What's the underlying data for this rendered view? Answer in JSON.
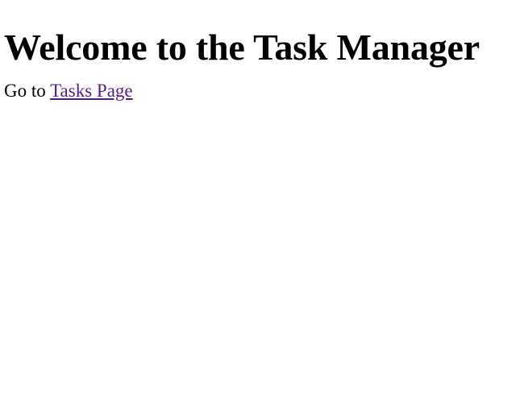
{
  "page": {
    "heading": "Welcome to the Task Manager",
    "nav_prefix": "Go to ",
    "nav_link_label": "Tasks Page"
  },
  "colors": {
    "background": "#ffffff",
    "text": "#000000",
    "visited_link": "#551a8b"
  }
}
